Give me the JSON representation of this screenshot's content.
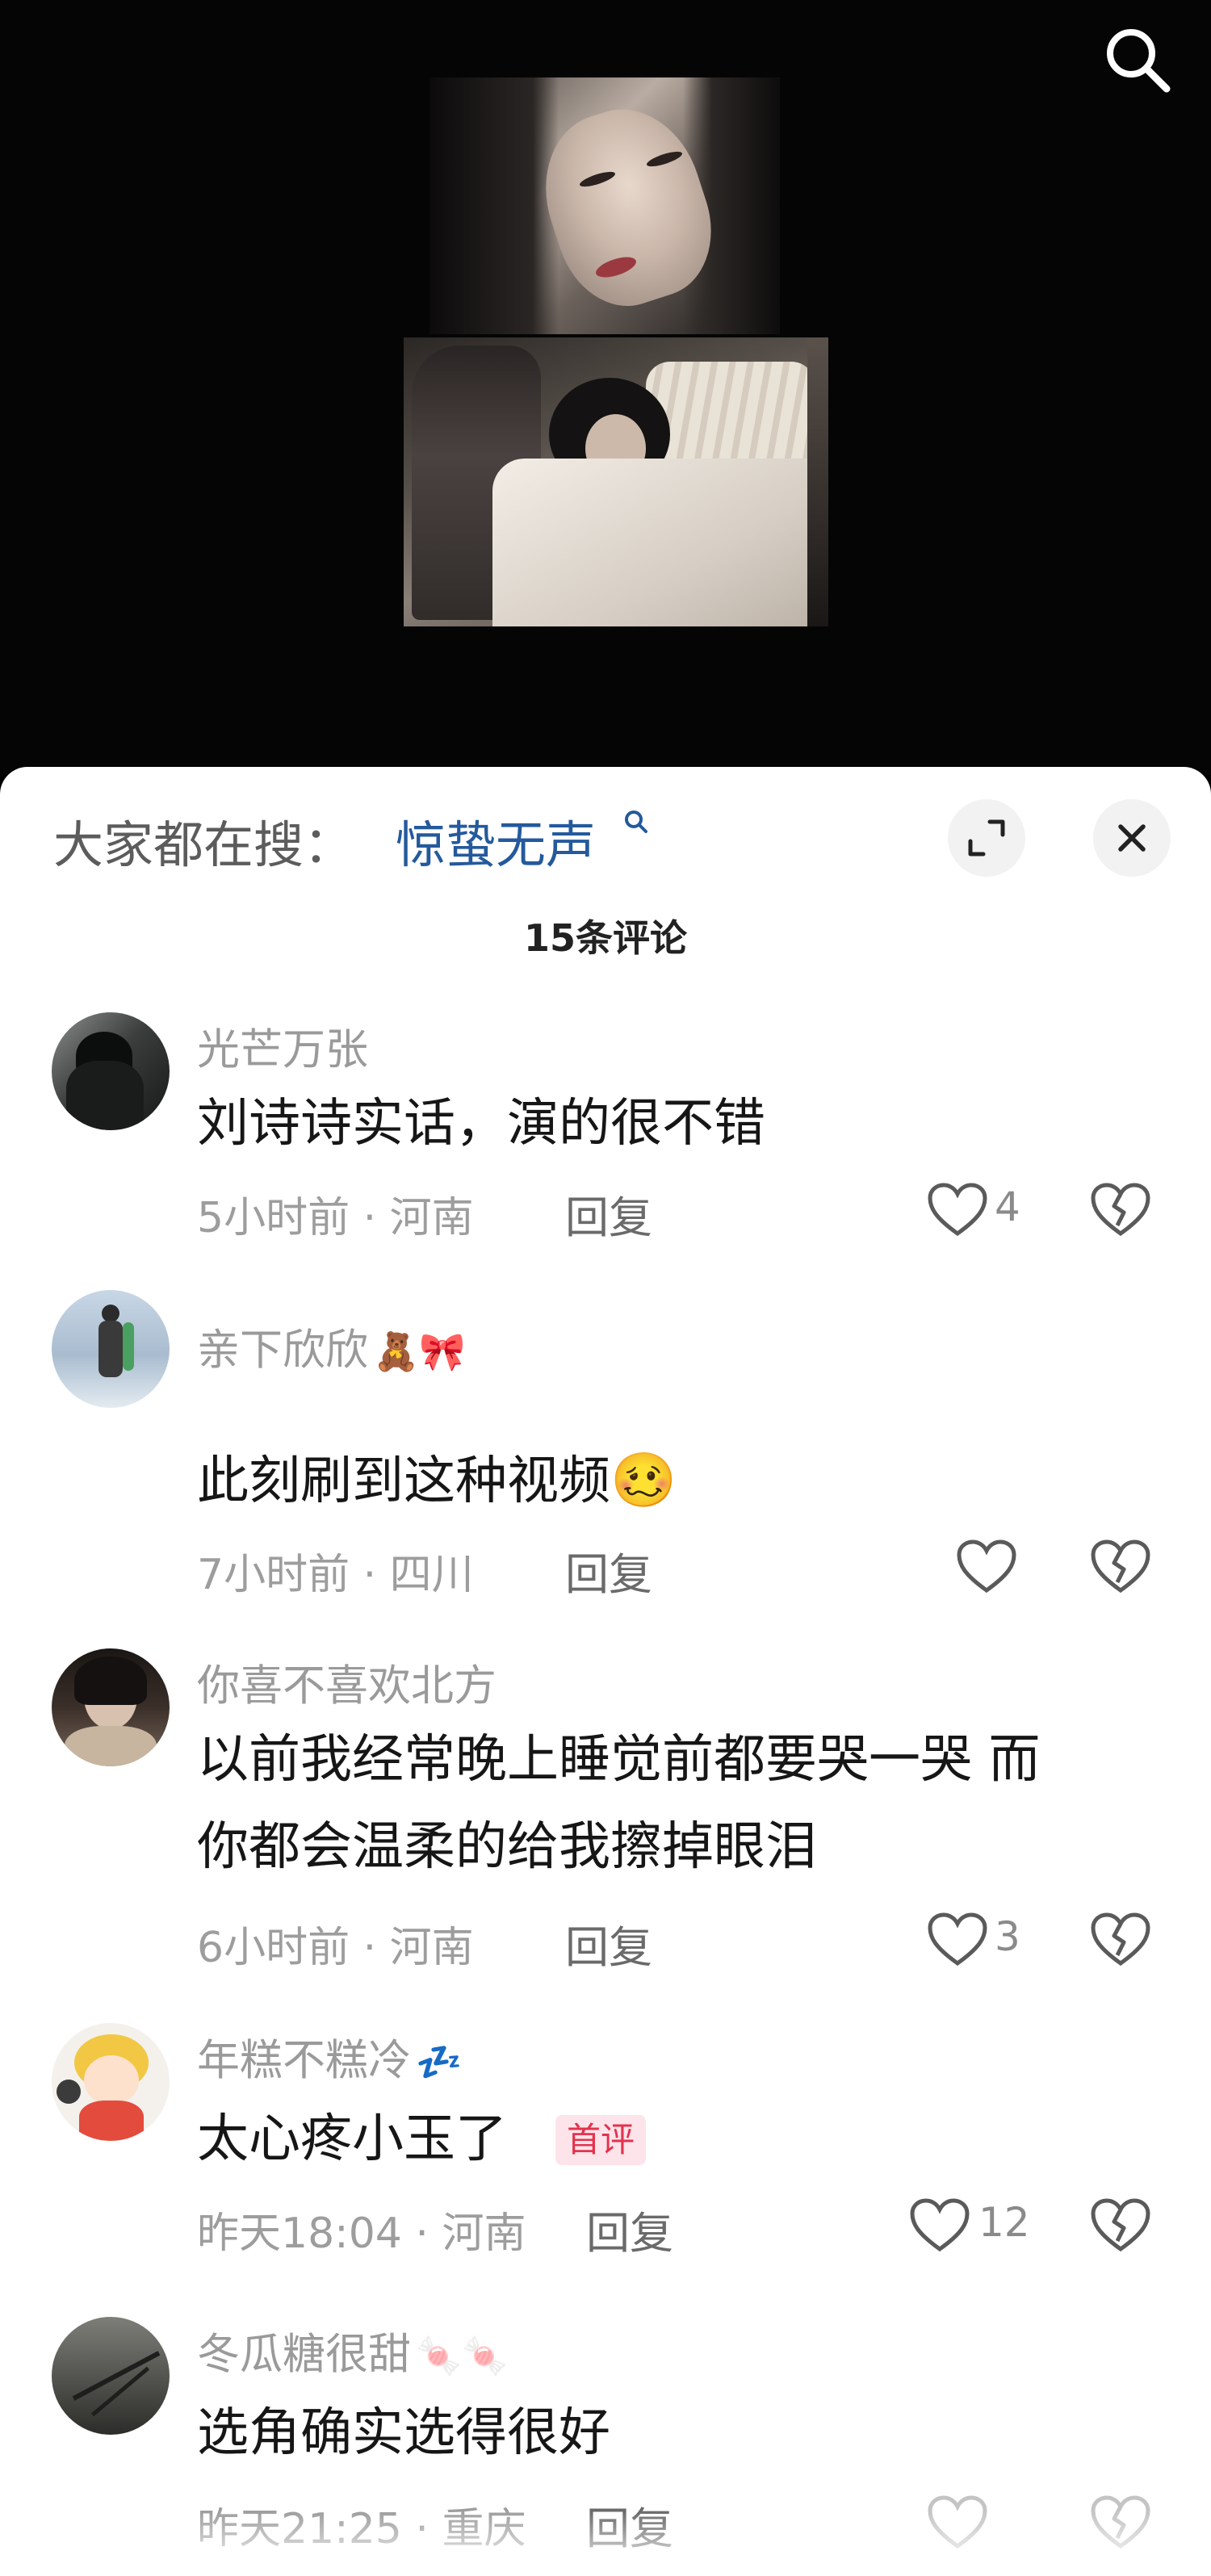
{
  "video": {
    "search_icon": "search-icon"
  },
  "sheet": {
    "search_hint_label": "大家都在搜：",
    "search_hint_term": "惊蛰无声",
    "expand_icon": "expand-icon",
    "close_icon": "close-icon",
    "comment_count": "15条评论"
  },
  "comments": [
    {
      "username": "光芒万张",
      "text": "刘诗诗实话，演的很不错",
      "time": "5小时前",
      "location": "河南",
      "meta": "5小时前 · 河南",
      "reply": "回复",
      "likes": "4"
    },
    {
      "username": "亲下欣欣",
      "username_deco": "🧸🎀",
      "text": "此刻刷到这种视频",
      "text_emoji": "🥴",
      "time": "7小时前",
      "location": "四川",
      "meta": "7小时前 · 四川",
      "reply": "回复",
      "likes": ""
    },
    {
      "username": "你喜不喜欢北方",
      "text_line1": "以前我经常晚上睡觉前都要哭一哭  而",
      "text_line2": "你都会温柔的给我擦掉眼泪",
      "time": "6小时前",
      "location": "河南",
      "meta": "6小时前 · 河南",
      "reply": "回复",
      "likes": "3"
    },
    {
      "username": "年糕不糕冷",
      "username_deco": "💤",
      "text": "太心疼小玉了",
      "badge": "首评",
      "time": "昨天18:04",
      "location": "河南",
      "meta": "昨天18:04 · 河南",
      "reply": "回复",
      "likes": "12"
    },
    {
      "username": "冬瓜糖很甜",
      "username_deco": "🍬🍬",
      "text": "选角确实选得很好",
      "time": "昨天21:25",
      "location": "重庆",
      "meta": "昨天21:25 · 重庆",
      "reply": "回复",
      "likes": ""
    }
  ],
  "colors": {
    "search_term": "#245a9c",
    "badge_text": "#e3334e",
    "badge_bg": "#fde4ea"
  }
}
